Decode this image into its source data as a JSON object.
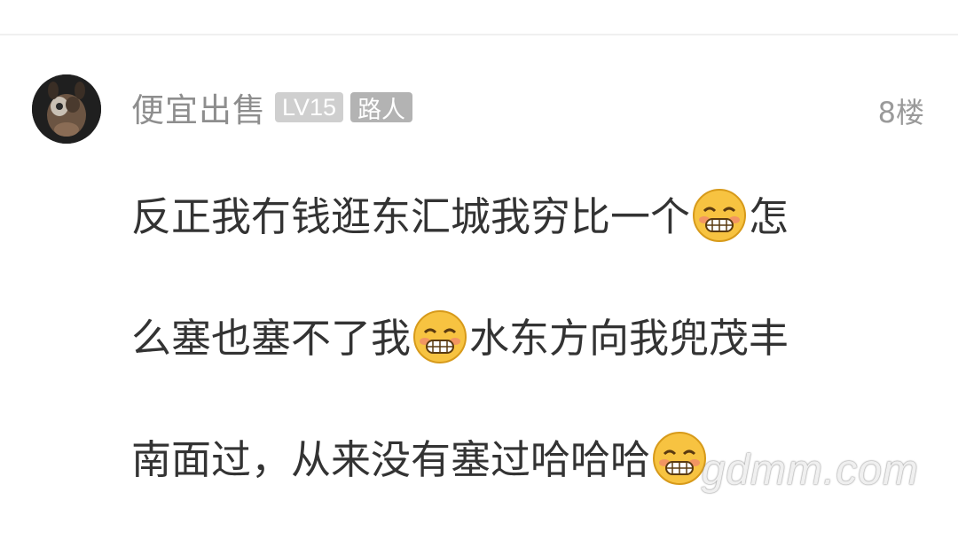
{
  "post": {
    "username": "便宜出售",
    "level_badge": "LV15",
    "role_badge": "路人",
    "floor": "8楼",
    "lines": [
      [
        "反正我冇钱逛东汇城我穷比一个",
        "怎"
      ],
      [
        "么塞也塞不了我",
        "水东方向我兜茂丰"
      ],
      [
        "南面过，从来没有塞过哈哈哈",
        ""
      ]
    ],
    "emoji_icon": "grinning-emoji-icon"
  },
  "watermark": "gdmm.com",
  "colors": {
    "username": "#8e8e8e",
    "level_badge_bg": "#cfcfcf",
    "role_badge_bg": "#b3b3b3",
    "body_text": "#333333",
    "floor_text": "#9a9a9a"
  }
}
